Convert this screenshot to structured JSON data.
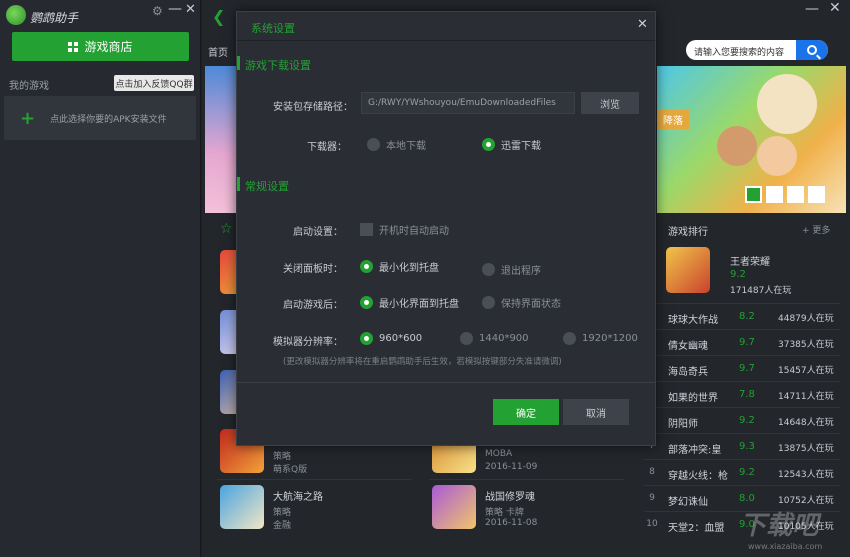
{
  "app": {
    "brand": "鹦鹉助手",
    "store_button": "游戏商店",
    "my_games": "我的游戏",
    "feedback_button": "点击加入反馈QQ群",
    "add_apk": "点此选择你要的APK安装文件"
  },
  "header": {
    "home": "首页",
    "search_placeholder": "请输入您要搜索的内容"
  },
  "banner": {
    "label": "降落"
  },
  "games": [
    {
      "name": "",
      "cat": "策略",
      "sub": "萌系Q版"
    },
    {
      "name": "大航海之路",
      "cat": "策略",
      "sub": "金融"
    },
    {
      "name": "",
      "cat": "MOBA",
      "sub": "2016-11-09"
    },
    {
      "name": "战国修罗魂",
      "cat": "策略 卡牌",
      "sub": "2016-11-08"
    }
  ],
  "ranking": {
    "title": "游戏排行",
    "more": "+ 更多",
    "top": {
      "name": "王者荣耀",
      "score": "9.2",
      "players": "171487人在玩"
    },
    "rows": [
      {
        "no": "",
        "name": "球球大作战",
        "score": "8.2",
        "players": "44879人在玩"
      },
      {
        "no": "",
        "name": "倩女幽魂",
        "score": "9.7",
        "players": "37385人在玩"
      },
      {
        "no": "",
        "name": "海岛奇兵",
        "score": "9.7",
        "players": "15457人在玩"
      },
      {
        "no": "",
        "name": "如果的世界",
        "score": "7.8",
        "players": "14711人在玩"
      },
      {
        "no": "",
        "name": "阴阳师",
        "score": "9.2",
        "players": "14648人在玩"
      },
      {
        "no": "7",
        "name": "部落冲突:皇",
        "score": "9.3",
        "players": "13875人在玩"
      },
      {
        "no": "8",
        "name": "穿越火线：枪",
        "score": "9.2",
        "players": "12543人在玩"
      },
      {
        "no": "9",
        "name": "梦幻诛仙",
        "score": "8.0",
        "players": "10752人在玩"
      },
      {
        "no": "10",
        "name": "天堂2：血盟",
        "score": "9.0",
        "players": "10105人在玩"
      }
    ]
  },
  "dialog": {
    "title": "系统设置",
    "section_download": "游戏下载设置",
    "label_path": "安装包存储路径：",
    "path_value": "G:/RWY/YWshouyou/EmuDownloadedFiles",
    "browse": "浏览",
    "label_downloader": "下载器：",
    "opt_local": "本地下载",
    "opt_thunder": "迅雷下载",
    "section_general": "常规设置",
    "label_startup": "启动设置：",
    "opt_autostart": "开机时自动启动",
    "label_close": "关闭面板时：",
    "opt_minimize_tray": "最小化到托盘",
    "opt_exit": "退出程序",
    "label_launch": "启动游戏后：",
    "opt_min_ui_tray": "最小化界面到托盘",
    "opt_keep_ui": "保持界面状态",
    "label_resolution": "模拟器分辨率：",
    "res_1": "960*600",
    "res_2": "1440*900",
    "res_3": "1920*1200",
    "note": "(更改模拟器分辨率将在重启鹦鹉助手后生效，若模拟按键部分失准请微调)",
    "ok": "确定",
    "cancel": "取消"
  },
  "watermark": {
    "text": "下载吧",
    "sub": "www.xiazaiba.com"
  },
  "colors": {
    "accent": "#23a133",
    "search_button": "#1a73e8"
  }
}
